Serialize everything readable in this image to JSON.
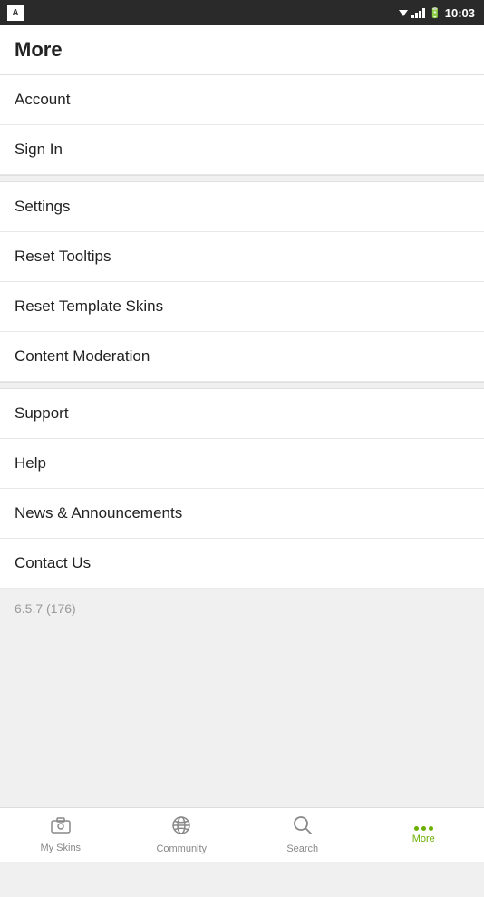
{
  "statusBar": {
    "time": "10:03"
  },
  "header": {
    "title": "More"
  },
  "menu": {
    "items": [
      {
        "id": "account",
        "label": "Account"
      },
      {
        "id": "sign-in",
        "label": "Sign In"
      },
      {
        "id": "settings",
        "label": "Settings"
      },
      {
        "id": "reset-tooltips",
        "label": "Reset Tooltips"
      },
      {
        "id": "reset-template-skins",
        "label": "Reset Template Skins"
      },
      {
        "id": "content-moderation",
        "label": "Content Moderation"
      },
      {
        "id": "support",
        "label": "Support"
      },
      {
        "id": "help",
        "label": "Help"
      },
      {
        "id": "news-announcements",
        "label": "News & Announcements"
      },
      {
        "id": "contact-us",
        "label": "Contact Us"
      }
    ],
    "version": "6.5.7 (176)"
  },
  "bottomNav": {
    "items": [
      {
        "id": "my-skins",
        "label": "My Skins",
        "icon": "skins",
        "active": false
      },
      {
        "id": "community",
        "label": "Community",
        "icon": "globe",
        "active": false
      },
      {
        "id": "search",
        "label": "Search",
        "icon": "search",
        "active": false
      },
      {
        "id": "more",
        "label": "More",
        "icon": "dots",
        "active": true
      }
    ]
  }
}
